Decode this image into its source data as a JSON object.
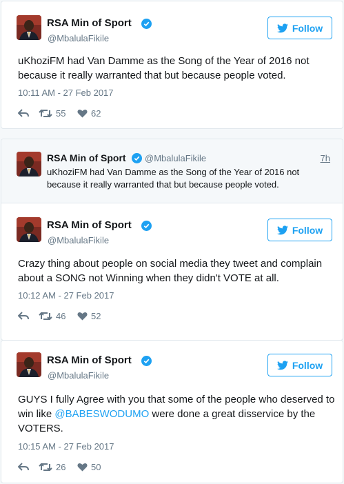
{
  "author": {
    "name": "RSA Min of Sport",
    "handle": "@MbalulaFikile"
  },
  "follow_label": "Follow",
  "tweets": [
    {
      "text": "uKhoziFM had Van Damme as the Song of the Year of 2016 not because it really warranted that but because people voted.",
      "timestamp": "10:11 AM - 27 Feb 2017",
      "retweets": "55",
      "likes": "62"
    },
    {
      "quote": {
        "text": "uKhoziFM had Van Damme as the Song of the Year of 2016 not because it really warranted that but because people voted.",
        "time": "7h"
      },
      "text": "Crazy thing about people on social media they tweet and complain about a SONG not Winning when they didn't VOTE at all.",
      "timestamp": "10:12 AM - 27 Feb 2017",
      "retweets": "46",
      "likes": "52"
    },
    {
      "text_before": "GUYS I fully Agree with you that some of the people who deserved to win like ",
      "mention": "@BABESWODUMO",
      "text_after": " were done a great disservice by the VOTERS.",
      "timestamp": "10:15 AM - 27 Feb 2017",
      "retweets": "26",
      "likes": "50"
    }
  ],
  "colors": {
    "accent": "#1da1f2",
    "verified": "#1da1f2",
    "muted": "#657786",
    "text": "#14171a"
  },
  "icons": {
    "reply": "reply-icon",
    "retweet": "retweet-icon",
    "like": "heart-icon",
    "verified": "verified-badge-icon",
    "bird": "twitter-bird-icon"
  }
}
